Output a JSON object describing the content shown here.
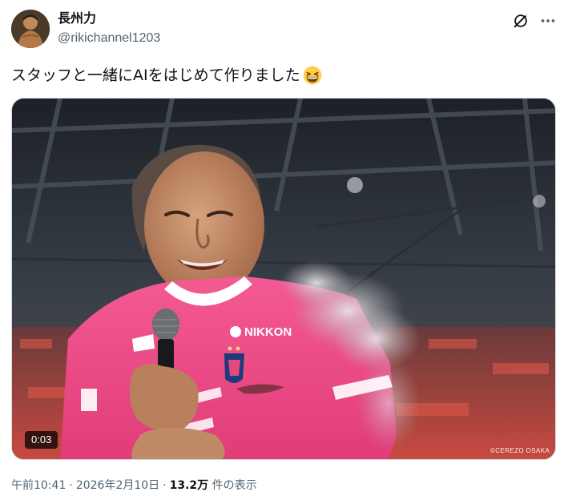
{
  "author": {
    "display_name": "長州力",
    "handle": "@rikichannel1203"
  },
  "tweet": {
    "text": "スタッフと一緒にAIをはじめて作りました",
    "emoji": "grinning-squinting-face"
  },
  "media": {
    "duration": "0:03",
    "watermark": "©CEREZO OSAKA",
    "jersey_sponsor": "NIKKON",
    "colors": {
      "jersey_pink": "#f0508a",
      "stadium_dark": "#2a3038",
      "crowd_red": "#c43a3a"
    }
  },
  "meta": {
    "time": "午前10:41",
    "date": "2026年2月10日",
    "views_count": "13.2万",
    "views_label": "件の表示"
  },
  "icons": {
    "grok": "grok-icon",
    "more": "more-dots-icon"
  }
}
